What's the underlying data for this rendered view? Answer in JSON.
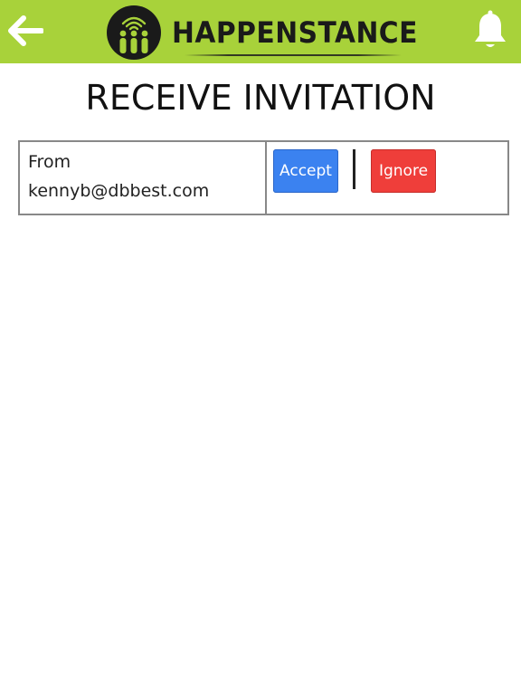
{
  "header": {
    "brand": "HAPPENSTANCE",
    "background_color": "#a8d23a",
    "back_icon": "arrow-left-icon",
    "notification_icon": "bell-icon"
  },
  "page": {
    "title": "RECEIVE INVITATION"
  },
  "invitation": {
    "from_label": "From",
    "from_email": "kennyb@dbbest.com",
    "accept_label": "Accept",
    "ignore_label": "Ignore",
    "accept_color": "#3b82f0",
    "ignore_color": "#ef3e3a"
  }
}
